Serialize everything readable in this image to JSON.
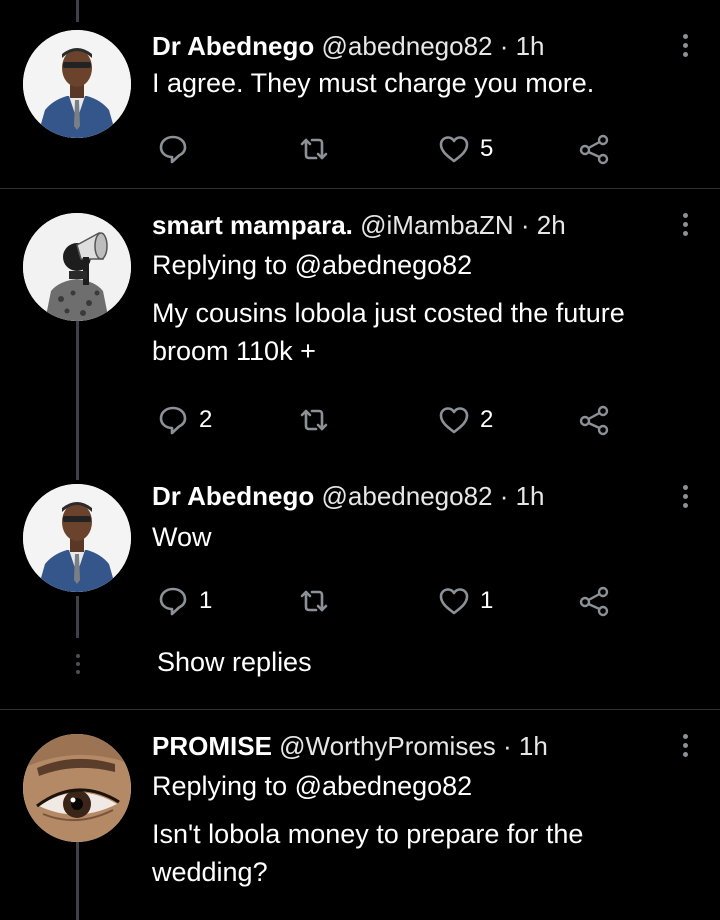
{
  "tweets": [
    {
      "name": "Dr Abednego",
      "meta": "@abednego82 · 1h",
      "replying": "",
      "text": "I agree. They must charge you more.",
      "replies": "",
      "likes": "5"
    },
    {
      "name": "smart mampara.",
      "meta": "@iMambaZN · 2h",
      "replying": "Replying to @abednego82",
      "text": "My cousins lobola just costed the future broom 110k +",
      "replies": "2",
      "likes": "2"
    },
    {
      "name": "Dr Abednego",
      "meta": "@abednego82 · 1h",
      "replying": "",
      "text": "Wow",
      "replies": "1",
      "likes": "1"
    },
    {
      "name": "PROMISE",
      "meta": "@WorthyPromises · 1h",
      "replying": "Replying to @abednego82",
      "text": "Isn't lobola money to prepare for the wedding?",
      "replies": "",
      "likes": ""
    }
  ],
  "show_replies": "Show replies",
  "icons": {
    "reply": "reply-icon",
    "retweet": "retweet-icon",
    "like": "heart-icon",
    "share": "share-icon",
    "more": "more-options-icon"
  },
  "colors": {
    "background": "#000000",
    "text": "#ffffff",
    "icon": "#8b9196",
    "divider": "#2f3336"
  }
}
